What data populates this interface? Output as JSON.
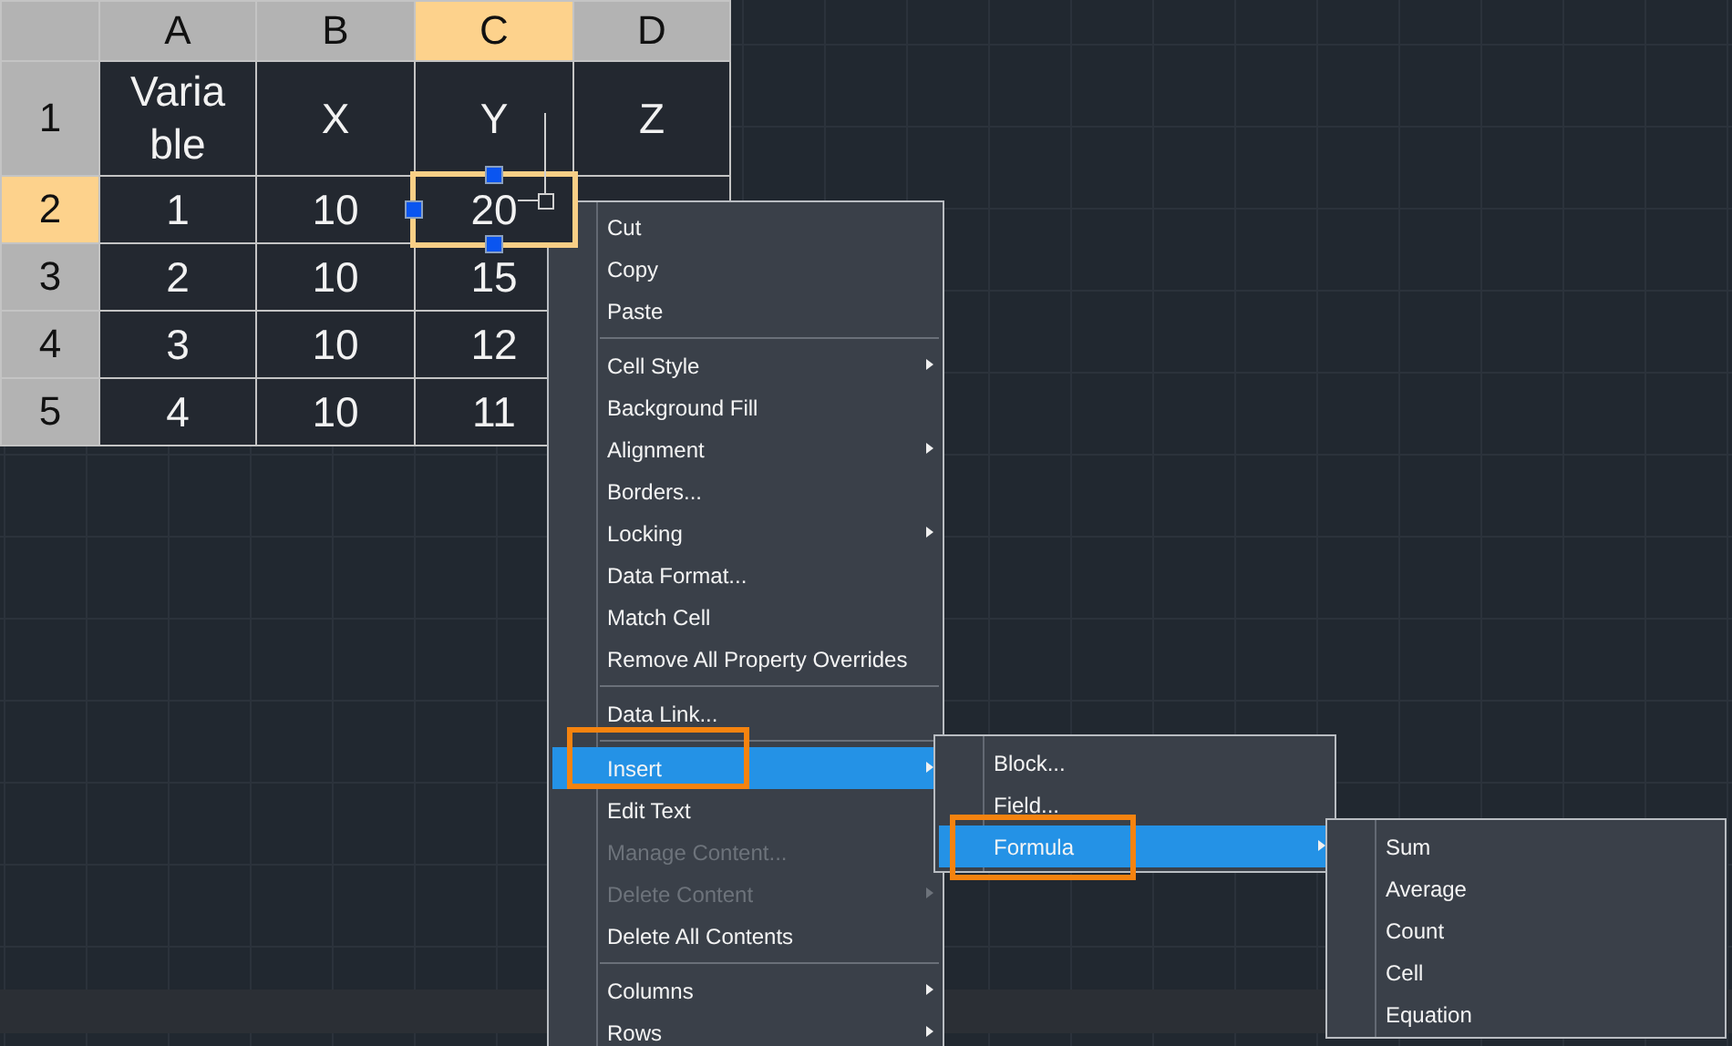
{
  "table": {
    "columns": [
      {
        "label": "A",
        "selected": false
      },
      {
        "label": "B",
        "selected": false
      },
      {
        "label": "C",
        "selected": true
      },
      {
        "label": "D",
        "selected": false
      }
    ],
    "rows": [
      {
        "label": "1",
        "selected": false,
        "cells": [
          {
            "value": "Varia\nble",
            "selected": false
          },
          {
            "value": "X",
            "selected": false
          },
          {
            "value": "Y",
            "selected": false
          },
          {
            "value": "Z",
            "selected": false
          }
        ]
      },
      {
        "label": "2",
        "selected": true,
        "cells": [
          {
            "value": "1",
            "selected": false
          },
          {
            "value": "10",
            "selected": false
          },
          {
            "value": "20",
            "selected": true
          },
          {
            "selected": false
          }
        ]
      },
      {
        "label": "3",
        "selected": false,
        "cells": [
          {
            "value": "2",
            "selected": false
          },
          {
            "value": "10",
            "selected": false
          },
          {
            "value": "15",
            "selected": false
          }
        ]
      },
      {
        "label": "4",
        "selected": false,
        "cells": [
          {
            "value": "3",
            "selected": false
          },
          {
            "value": "10",
            "selected": false
          },
          {
            "value": "12",
            "selected": false
          }
        ]
      },
      {
        "label": "5",
        "selected": false,
        "cells": [
          {
            "value": "4",
            "selected": false
          },
          {
            "value": "10",
            "selected": false
          },
          {
            "value": "11",
            "selected": false
          }
        ]
      }
    ]
  },
  "context_menu": {
    "items": [
      {
        "kind": "item",
        "label": "Cut",
        "submenu": false,
        "disabled": false,
        "selected": false,
        "annotated": false
      },
      {
        "kind": "item",
        "label": "Copy",
        "submenu": false,
        "disabled": false,
        "selected": false,
        "annotated": false
      },
      {
        "kind": "item",
        "label": "Paste",
        "submenu": false,
        "disabled": false,
        "selected": false,
        "annotated": false
      },
      {
        "kind": "separator"
      },
      {
        "kind": "item",
        "label": "Cell Style",
        "submenu": true,
        "disabled": false,
        "selected": false,
        "annotated": false
      },
      {
        "kind": "item",
        "label": "Background Fill",
        "submenu": false,
        "disabled": false,
        "selected": false,
        "annotated": false
      },
      {
        "kind": "item",
        "label": "Alignment",
        "submenu": true,
        "disabled": false,
        "selected": false,
        "annotated": false
      },
      {
        "kind": "item",
        "label": "Borders...",
        "submenu": false,
        "disabled": false,
        "selected": false,
        "annotated": false
      },
      {
        "kind": "item",
        "label": "Locking",
        "submenu": true,
        "disabled": false,
        "selected": false,
        "annotated": false
      },
      {
        "kind": "item",
        "label": "Data Format...",
        "submenu": false,
        "disabled": false,
        "selected": false,
        "annotated": false
      },
      {
        "kind": "item",
        "label": "Match Cell",
        "submenu": false,
        "disabled": false,
        "selected": false,
        "annotated": false
      },
      {
        "kind": "item",
        "label": "Remove All Property Overrides",
        "submenu": false,
        "disabled": false,
        "selected": false,
        "annotated": false
      },
      {
        "kind": "separator"
      },
      {
        "kind": "item",
        "label": "Data Link...",
        "submenu": false,
        "disabled": false,
        "selected": false,
        "annotated": false
      },
      {
        "kind": "separator"
      },
      {
        "kind": "item",
        "label": "Insert",
        "submenu": true,
        "disabled": false,
        "selected": true,
        "annotated": true
      },
      {
        "kind": "item",
        "label": "Edit Text",
        "submenu": false,
        "disabled": false,
        "selected": false,
        "annotated": false
      },
      {
        "kind": "item",
        "label": "Manage Content...",
        "submenu": false,
        "disabled": true,
        "selected": false,
        "annotated": false
      },
      {
        "kind": "item",
        "label": "Delete Content",
        "submenu": true,
        "disabled": true,
        "selected": false,
        "annotated": false
      },
      {
        "kind": "item",
        "label": "Delete All Contents",
        "submenu": false,
        "disabled": false,
        "selected": false,
        "annotated": false
      },
      {
        "kind": "separator"
      },
      {
        "kind": "item",
        "label": "Columns",
        "submenu": true,
        "disabled": false,
        "selected": false,
        "annotated": false
      },
      {
        "kind": "item",
        "label": "Rows",
        "submenu": true,
        "disabled": false,
        "selected": false,
        "annotated": false
      }
    ]
  },
  "insert_submenu": {
    "items": [
      {
        "kind": "item",
        "label": "Block...",
        "submenu": false,
        "disabled": false,
        "selected": false,
        "annotated": false
      },
      {
        "kind": "item",
        "label": "Field...",
        "submenu": false,
        "disabled": false,
        "selected": false,
        "annotated": false
      },
      {
        "kind": "item",
        "label": "Formula",
        "submenu": true,
        "disabled": false,
        "selected": true,
        "annotated": true
      }
    ]
  },
  "formula_submenu": {
    "items": [
      {
        "kind": "item",
        "label": "Sum",
        "submenu": false,
        "disabled": false,
        "selected": false,
        "annotated": false
      },
      {
        "kind": "item",
        "label": "Average",
        "submenu": false,
        "disabled": false,
        "selected": false,
        "annotated": false
      },
      {
        "kind": "item",
        "label": "Count",
        "submenu": false,
        "disabled": false,
        "selected": false,
        "annotated": false
      },
      {
        "kind": "item",
        "label": "Cell",
        "submenu": false,
        "disabled": false,
        "selected": false,
        "annotated": false
      },
      {
        "kind": "item",
        "label": "Equation",
        "submenu": false,
        "disabled": false,
        "selected": false,
        "annotated": false
      }
    ]
  }
}
